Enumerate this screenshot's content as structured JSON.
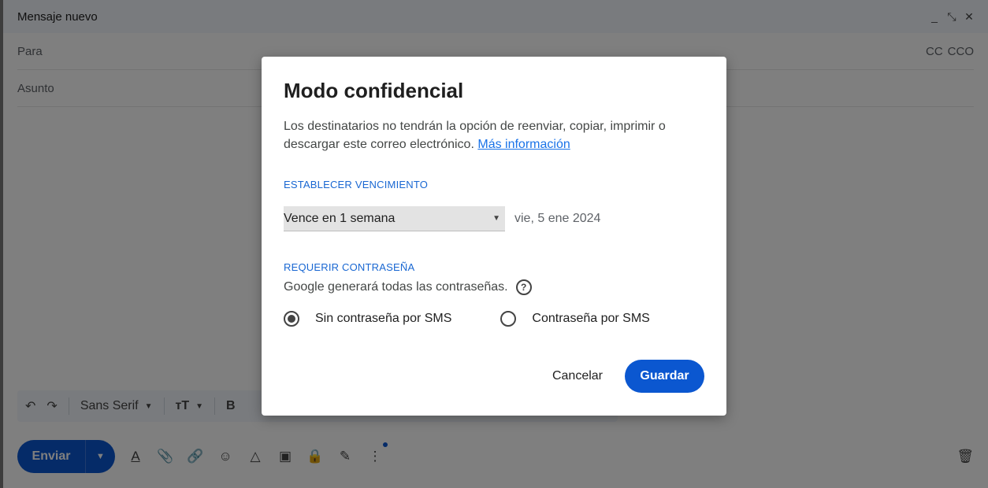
{
  "compose": {
    "title": "Mensaje nuevo",
    "window_controls": [
      "_",
      "⤡",
      "✕"
    ],
    "to_label": "Para",
    "cc_label": "CC",
    "bcc_label": "CCO",
    "subject_label": "Asunto",
    "font_name": "Sans Serif",
    "send_label": "Enviar"
  },
  "dialog": {
    "title": "Modo confidencial",
    "description": "Los destinatarios no tendrán la opción de reenviar, copiar, imprimir o descargar este correo electrónico.",
    "learn_more": "Más información",
    "expiry_section": "ESTABLECER VENCIMIENTO",
    "expiry_value": "Vence en 1 semana",
    "expiry_date": "vie, 5 ene 2024",
    "password_section": "REQUERIR CONTRASEÑA",
    "password_note": "Google generará todas las contraseñas.",
    "radio_no_sms": "Sin contraseña por SMS",
    "radio_sms": "Contraseña por SMS",
    "cancel": "Cancelar",
    "save": "Guardar"
  },
  "colors": {
    "accent": "#0b57d0",
    "link": "#1a73e8",
    "section_label": "#1967d2"
  }
}
